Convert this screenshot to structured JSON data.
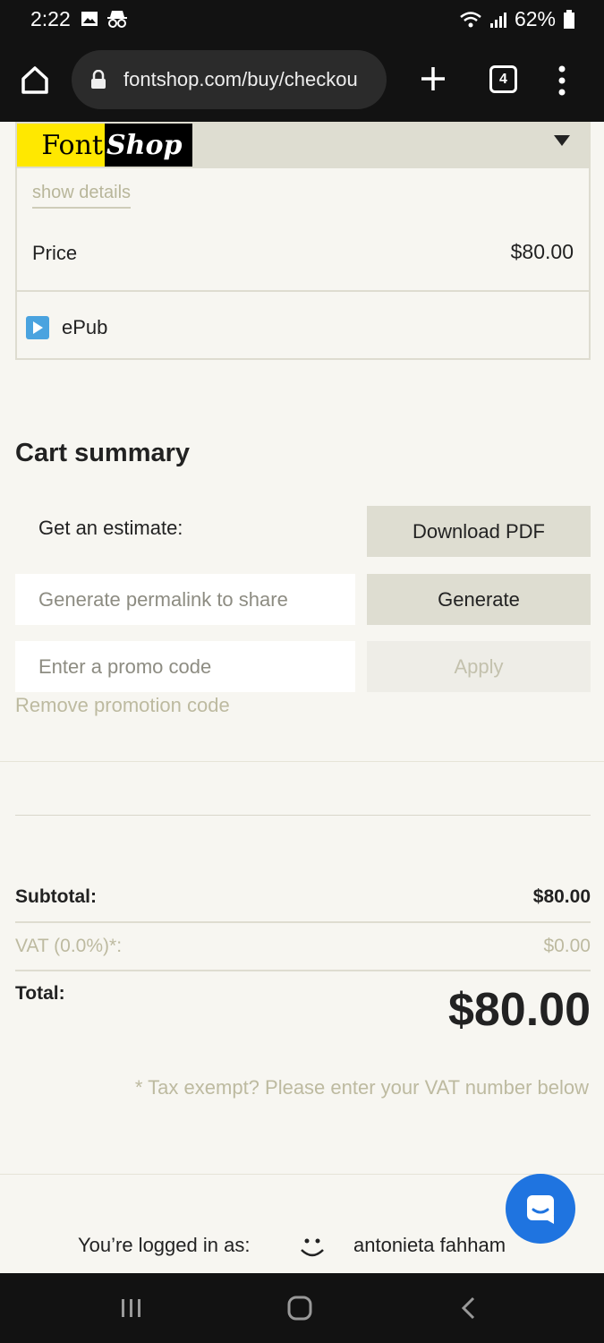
{
  "status": {
    "time": "2:22",
    "battery": "62%"
  },
  "browser": {
    "url": "fontshop.com/buy/checkou",
    "tab_count": "4"
  },
  "brand": {
    "logo_left": "Font",
    "logo_right": "Shop"
  },
  "product": {
    "show_details": "show details",
    "price_label": "Price",
    "price_value": "$80.00",
    "format": "ePub"
  },
  "cart": {
    "title": "Cart summary",
    "estimate_label": "Get an estimate:",
    "download_pdf": "Download PDF",
    "permalink_placeholder": "Generate permalink to share",
    "generate": "Generate",
    "promo_placeholder": "Enter a promo code",
    "apply": "Apply",
    "remove_promo": "Remove promotion code"
  },
  "summary": {
    "subtotal_label": "Subtotal:",
    "subtotal_value": "$80.00",
    "vat_label": "VAT (0.0%)*:",
    "vat_value": "$0.00",
    "total_label": "Total:",
    "total_value": "$80.00",
    "tax_note": "* Tax exempt? Please enter your VAT number below"
  },
  "account": {
    "logged_in_label": "You’re logged in as:",
    "user_name": "antonieta fahham"
  },
  "colors": {
    "accent": "#1f74e0",
    "logo_yellow": "#ffe800"
  }
}
